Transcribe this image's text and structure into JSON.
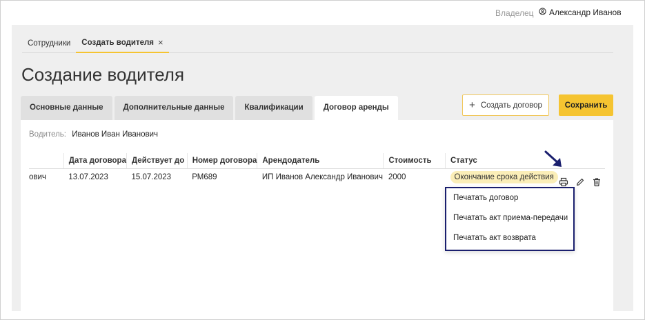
{
  "header": {
    "owner_label": "Владелец",
    "user_name": "Александр Иванов"
  },
  "page_tabs": [
    {
      "label": "Сотрудники"
    },
    {
      "label": "Создать водителя",
      "close": "×"
    }
  ],
  "page_title": "Создание водителя",
  "section_tabs": [
    {
      "label": "Основные данные"
    },
    {
      "label": "Дополнительные данные"
    },
    {
      "label": "Квалификации"
    },
    {
      "label": "Договор аренды"
    }
  ],
  "active_section_tab": "Договор аренды",
  "toolbar": {
    "create_contract_icon": "+",
    "create_contract_label": "Создать договор",
    "save_label": "Сохранить"
  },
  "driver": {
    "label": "Водитель:",
    "value": "Иванов Иван Иванович"
  },
  "table": {
    "columns": [
      "",
      "Дата договора",
      "Действует до",
      "Номер договора",
      "Арендодатель",
      "Стоимость",
      "Статус"
    ],
    "rows": [
      {
        "name": "ович",
        "date": "13.07.2023",
        "valid_until": "15.07.2023",
        "number": "РМ689",
        "lessor": "ИП Иванов Александр Иванович",
        "cost": "2000",
        "status": "Окончание срока действия"
      }
    ]
  },
  "print_menu": {
    "items": [
      "Печатать договор",
      "Печатать акт приема-передачи",
      "Печатать акт возврата"
    ]
  },
  "colors": {
    "accent": "#f5c431",
    "badge": "#fbeeb8",
    "menu_border": "#1a1f6e",
    "arrow": "#1a1f6e"
  },
  "icons": [
    "user-icon",
    "close-icon",
    "plus-icon",
    "print-icon",
    "edit-icon",
    "trash-icon",
    "arrow-icon"
  ]
}
